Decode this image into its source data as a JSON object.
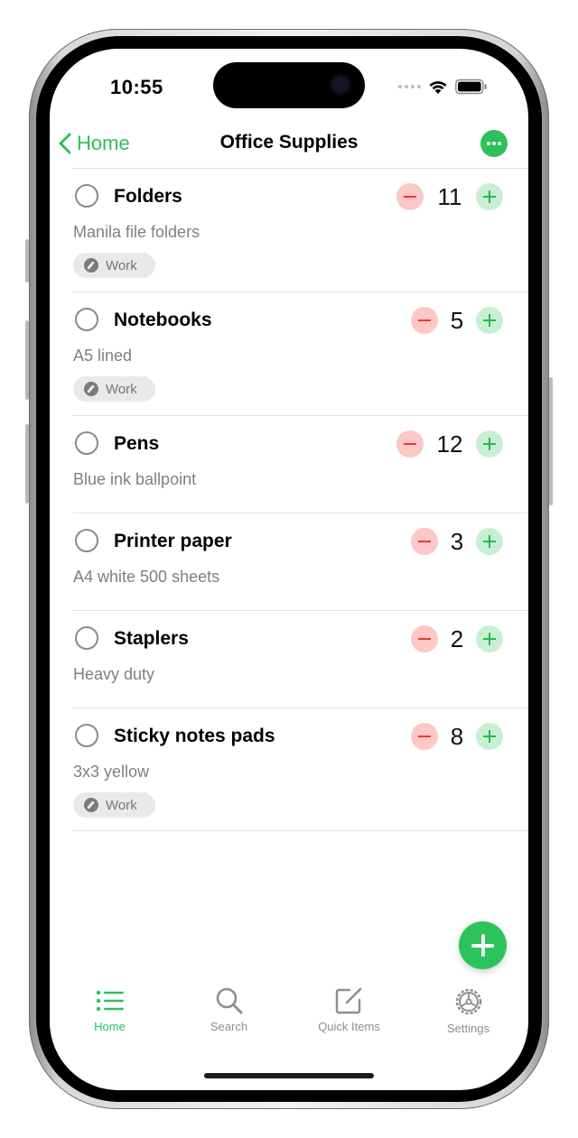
{
  "status": {
    "time": "10:55"
  },
  "nav": {
    "back_label": "Home",
    "title": "Office Supplies"
  },
  "colors": {
    "accent": "#2ec05a",
    "minus_bg": "#fcc7c5",
    "minus_fg": "#e83a35",
    "plus_bg": "#c9efd3",
    "plus_fg": "#28b74e"
  },
  "items": [
    {
      "name": "Folders",
      "description": "Manila file folders",
      "quantity": "11",
      "tag": "Work"
    },
    {
      "name": "Notebooks",
      "description": "A5 lined",
      "quantity": "5",
      "tag": "Work"
    },
    {
      "name": "Pens",
      "description": "Blue ink ballpoint",
      "quantity": "12",
      "tag": ""
    },
    {
      "name": "Printer paper",
      "description": "A4 white 500 sheets",
      "quantity": "3",
      "tag": ""
    },
    {
      "name": "Staplers",
      "description": "Heavy duty",
      "quantity": "2",
      "tag": ""
    },
    {
      "name": "Sticky notes pads",
      "description": "3x3 yellow",
      "quantity": "8",
      "tag": "Work"
    }
  ],
  "tabs": [
    {
      "label": "Home",
      "icon": "list-icon",
      "active": true
    },
    {
      "label": "Search",
      "icon": "search-icon",
      "active": false
    },
    {
      "label": "Quick Items",
      "icon": "compose-icon",
      "active": false
    },
    {
      "label": "Settings",
      "icon": "gear-icon",
      "active": false
    }
  ]
}
